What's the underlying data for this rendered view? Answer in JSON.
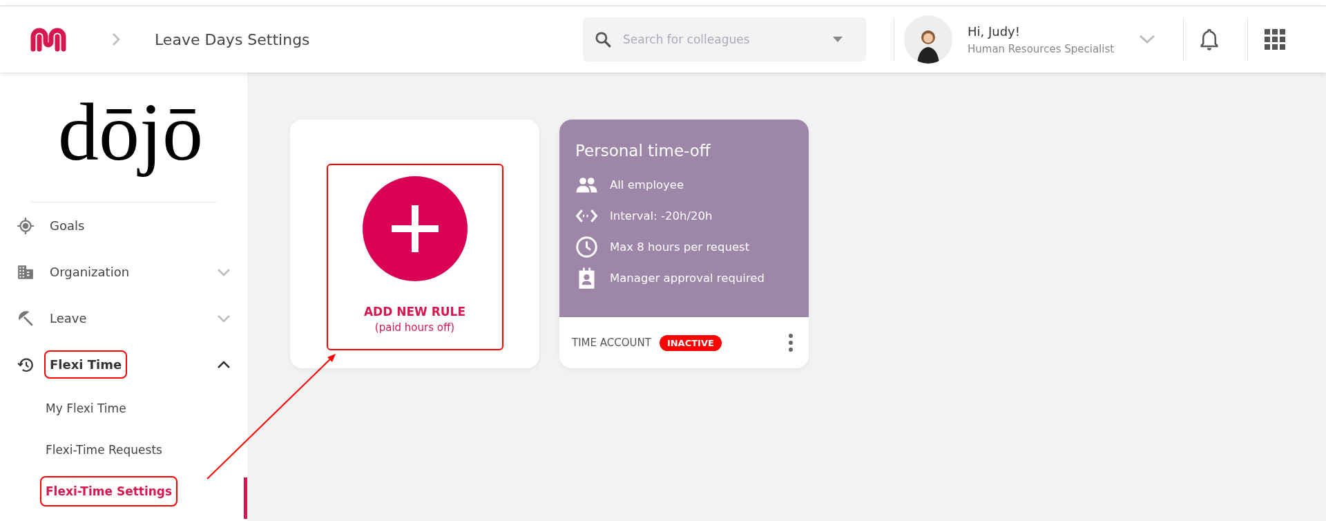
{
  "header": {
    "title": "Leave Days Settings",
    "search": {
      "placeholder": "Search for colleagues"
    },
    "user": {
      "greeting": "Hi, Judy!",
      "role": "Human Resources Specialist"
    }
  },
  "sidebar": {
    "logo": "dōjō",
    "items": [
      {
        "label": "Goals",
        "annotated": false
      },
      {
        "label": "Organization",
        "expanded": false,
        "annotated": false
      },
      {
        "label": "Leave",
        "expanded": false,
        "annotated": false
      },
      {
        "label": "Flexi Time",
        "expanded": true,
        "annotated": true,
        "children": [
          {
            "label": "My Flexi Time",
            "selected": false,
            "annotated": false
          },
          {
            "label": "Flexi-Time Requests",
            "selected": false,
            "annotated": false
          },
          {
            "label": "Flexi-Time Settings",
            "selected": true,
            "annotated": true
          }
        ]
      }
    ]
  },
  "add_card": {
    "title": "ADD NEW RULE",
    "subtitle": "(paid hours off)",
    "annotated": true
  },
  "rule_cards": [
    {
      "title": "Personal time-off",
      "color": "#9e86a8",
      "details": [
        {
          "text": "All employee"
        },
        {
          "text": "Interval: -20h/20h"
        },
        {
          "text": "Max 8 hours per request"
        },
        {
          "text": "Manager approval required"
        }
      ],
      "footer_label": "TIME ACCOUNT",
      "status": "INACTIVE",
      "active": false
    }
  ]
}
